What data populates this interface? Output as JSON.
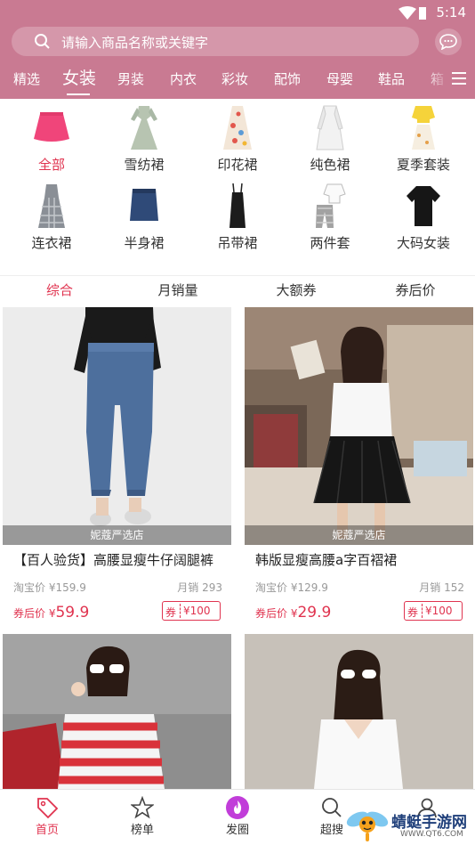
{
  "status": {
    "time": "5:14"
  },
  "search": {
    "placeholder": "请输入商品名称或关键字"
  },
  "tabs": [
    "精选",
    "女装",
    "男装",
    "内衣",
    "彩妆",
    "配饰",
    "母婴",
    "鞋品",
    "箱"
  ],
  "active_tab": "女装",
  "categories": [
    {
      "label": "全部",
      "icon": "skirt-pink-icon",
      "active": true
    },
    {
      "label": "雪纺裙",
      "icon": "floral-dress-icon"
    },
    {
      "label": "印花裙",
      "icon": "print-dress-icon"
    },
    {
      "label": "纯色裙",
      "icon": "white-dress-icon"
    },
    {
      "label": "夏季套装",
      "icon": "summer-set-icon"
    },
    {
      "label": "连衣裙",
      "icon": "plaid-dress-icon"
    },
    {
      "label": "半身裙",
      "icon": "denim-skirt-icon"
    },
    {
      "label": "吊带裙",
      "icon": "slip-dress-icon"
    },
    {
      "label": "两件套",
      "icon": "two-piece-icon"
    },
    {
      "label": "大码女装",
      "icon": "black-tee-icon"
    }
  ],
  "sort": [
    "综合",
    "月销量",
    "大额券",
    "券后价"
  ],
  "products": [
    {
      "shop": "妮蔻严选店",
      "title": "【百人验货】高腰显瘦牛仔阔腿裤",
      "taobao_label": "淘宝价",
      "taobao_price": "¥159.9",
      "sales": "月销 293",
      "after_label": "券后价",
      "after_currency": "¥",
      "after_price": "59.9",
      "coupon_label": "券",
      "coupon_value": "¥100"
    },
    {
      "shop": "妮蔻严选店",
      "title": "韩版显瘦高腰a字百褶裙",
      "taobao_label": "淘宝价",
      "taobao_price": "¥129.9",
      "sales": "月销 152",
      "after_label": "券后价",
      "after_currency": "¥",
      "after_price": "29.9",
      "coupon_label": "券",
      "coupon_value": "¥100"
    }
  ],
  "bottom_nav": [
    {
      "label": "首页",
      "icon": "tag-icon",
      "active": true
    },
    {
      "label": "榜单",
      "icon": "star-icon"
    },
    {
      "label": "发圈",
      "icon": "flame-icon"
    },
    {
      "label": "超搜",
      "icon": "search-icon"
    },
    {
      "label": "",
      "icon": "user-icon"
    }
  ],
  "watermark": {
    "text": "蜻蜓手游网",
    "url": "WWW.QT6.COM"
  },
  "colors": {
    "header": "#c97a92",
    "accent": "#e0334f"
  }
}
